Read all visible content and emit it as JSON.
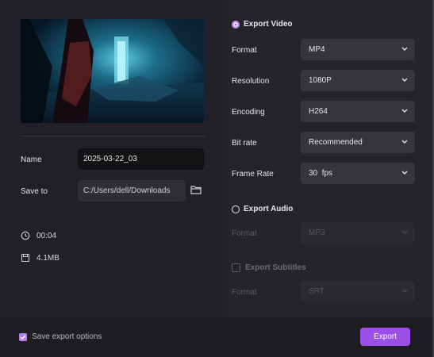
{
  "preview": {
    "alt": "video thumbnail"
  },
  "fields": {
    "name_label": "Name",
    "name_value": "2025-03-22_03",
    "save_to_label": "Save to",
    "save_to_value": "C:/Users/dell/Downloads"
  },
  "info": {
    "duration": "00:04",
    "size": "4.1MB"
  },
  "export_video": {
    "label": "Export Video",
    "selected": true,
    "format_label": "Format",
    "format_value": "MP4",
    "resolution_label": "Resolution",
    "resolution_value": "1080P",
    "encoding_label": "Encoding",
    "encoding_value": "H264",
    "bitrate_label": "Bit rate",
    "bitrate_value": "Recommended",
    "framerate_label": "Frame Rate",
    "framerate_value": "30  fps"
  },
  "export_audio": {
    "label": "Export Audio",
    "selected": false,
    "format_label": "Format",
    "format_value": "MP3"
  },
  "export_subtitles": {
    "label": "Export Subtitles",
    "checked": false,
    "format_label": "Format",
    "format_value": "SRT"
  },
  "footer": {
    "save_options_label": "Save export options",
    "save_options_checked": true,
    "export_label": "Export"
  },
  "colors": {
    "accent": "#9b4ee8",
    "background": "#24242a"
  }
}
